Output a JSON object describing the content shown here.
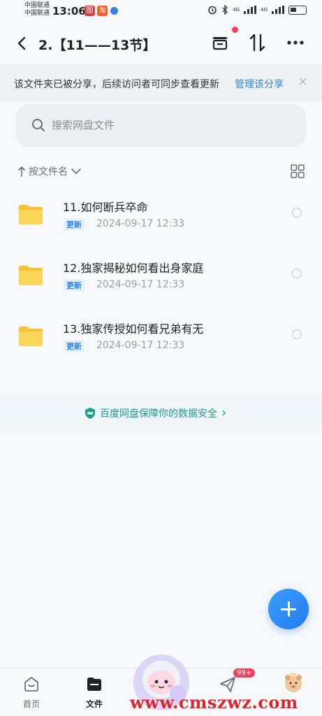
{
  "status": {
    "carrier_line1": "中国联通",
    "carrier_line2": "中国联通",
    "time": "13:06",
    "network": "4G"
  },
  "nav": {
    "title": "2.【11——13节】"
  },
  "share_banner": {
    "text": "该文件夹已被分享，后续访问者可同步查看更新",
    "link": "管理该分享",
    "close": "×"
  },
  "search": {
    "placeholder": "搜索网盘文件"
  },
  "sort": {
    "label": "按文件名"
  },
  "files": [
    {
      "name": "11.如何断兵卒命",
      "badge": "更新",
      "date": "2024-09-17  12:33"
    },
    {
      "name": "12.独家揭秘如何看出身家庭",
      "badge": "更新",
      "date": "2024-09-17  12:33"
    },
    {
      "name": "13.独家传授如何看兄弟有无",
      "badge": "更新",
      "date": "2024-09-17  12:33"
    }
  ],
  "security": {
    "text": "百度网盘保障你的数据安全",
    "chevron": "›"
  },
  "tabs": [
    {
      "label": "首页",
      "icon": "home-icon",
      "active": false
    },
    {
      "label": "文件",
      "icon": "folder-icon",
      "active": true
    },
    {
      "label": "",
      "icon": "mascot-icon",
      "active": false
    },
    {
      "label": "",
      "icon": "send-icon",
      "active": false
    },
    {
      "label": "",
      "icon": "avatar-icon",
      "active": false
    }
  ],
  "notification_badge": "99+",
  "watermark": "www.cmszwz.com",
  "colors": {
    "accent": "#2a86e8",
    "folder": "#f7c844",
    "security": "#1e9c8c",
    "badge_red": "#f0435a"
  }
}
